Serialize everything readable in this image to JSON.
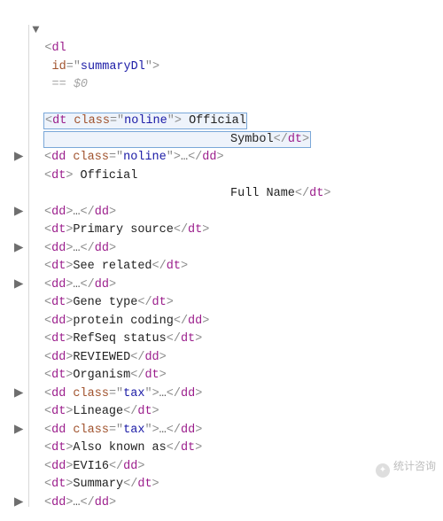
{
  "selected_hint": "== $0",
  "root": {
    "tag": "dl",
    "id_attr": "id",
    "id_val": "summaryDl"
  },
  "lines": [
    {
      "kind": "open_close_wrap",
      "tag": "dt",
      "class_val": "noline",
      "text1": "Official",
      "text2": "Symbol",
      "selected": true
    },
    {
      "kind": "collapsed_classed",
      "tag": "dd",
      "class_val": "noline"
    },
    {
      "kind": "open_wrap",
      "tag": "dt",
      "text1": "Official",
      "text2": "Full Name",
      "pad": true
    },
    {
      "kind": "collapsed",
      "tag": "dd"
    },
    {
      "kind": "text_pair",
      "tag": "dt",
      "text": "Primary source"
    },
    {
      "kind": "collapsed",
      "tag": "dd"
    },
    {
      "kind": "text_pair",
      "tag": "dt",
      "text": "See related"
    },
    {
      "kind": "collapsed",
      "tag": "dd"
    },
    {
      "kind": "text_pair",
      "tag": "dt",
      "text": "Gene type"
    },
    {
      "kind": "text_pair",
      "tag": "dd",
      "text": "protein coding"
    },
    {
      "kind": "text_pair",
      "tag": "dt",
      "text": "RefSeq status"
    },
    {
      "kind": "text_pair",
      "tag": "dd",
      "text": "REVIEWED"
    },
    {
      "kind": "text_pair",
      "tag": "dt",
      "text": "Organism"
    },
    {
      "kind": "collapsed_classed",
      "tag": "dd",
      "class_val": "tax"
    },
    {
      "kind": "text_pair",
      "tag": "dt",
      "text": "Lineage"
    },
    {
      "kind": "collapsed_classed",
      "tag": "dd",
      "class_val": "tax"
    },
    {
      "kind": "text_pair",
      "tag": "dt",
      "text": "Also known as"
    },
    {
      "kind": "text_pair",
      "tag": "dd",
      "text": "EVI16"
    },
    {
      "kind": "text_pair",
      "tag": "dt",
      "text": "Summary"
    },
    {
      "kind": "collapsed",
      "tag": "dd"
    }
  ],
  "watermark": "统计咨询"
}
